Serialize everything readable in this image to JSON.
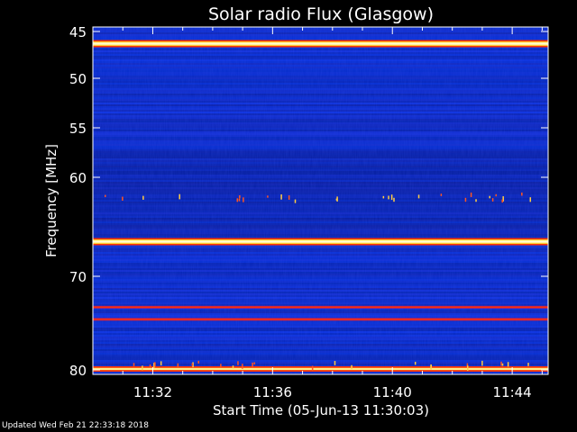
{
  "chart_data": {
    "type": "heatmap",
    "title": "Solar radio Flux (Glasgow)",
    "xlabel": "Start Time (05-Jun-13 11:30:03)",
    "ylabel": "Frequency [MHz]",
    "x_ticks": [
      "11:32",
      "11:36",
      "11:40",
      "11:44"
    ],
    "x_tick_minutes": [
      2,
      6,
      10,
      14
    ],
    "xlim_minutes": [
      0,
      15.2
    ],
    "y_ticks": [
      45,
      50,
      55,
      60,
      70,
      80
    ],
    "ylim": [
      45,
      80.2
    ],
    "y_axis_nonlinear": true,
    "y_axis_inverted": true,
    "intense_bands_mhz": [
      46.3,
      66.5,
      73.3,
      74.6,
      79.9
    ],
    "colors": {
      "background": "#000000",
      "low": "#000a7a",
      "mid": "#1a2cff",
      "high": "#ff3300",
      "peak": "#ffffd0"
    }
  },
  "footer": {
    "updated": "Updated Wed Feb 21 22:33:18 2018"
  }
}
